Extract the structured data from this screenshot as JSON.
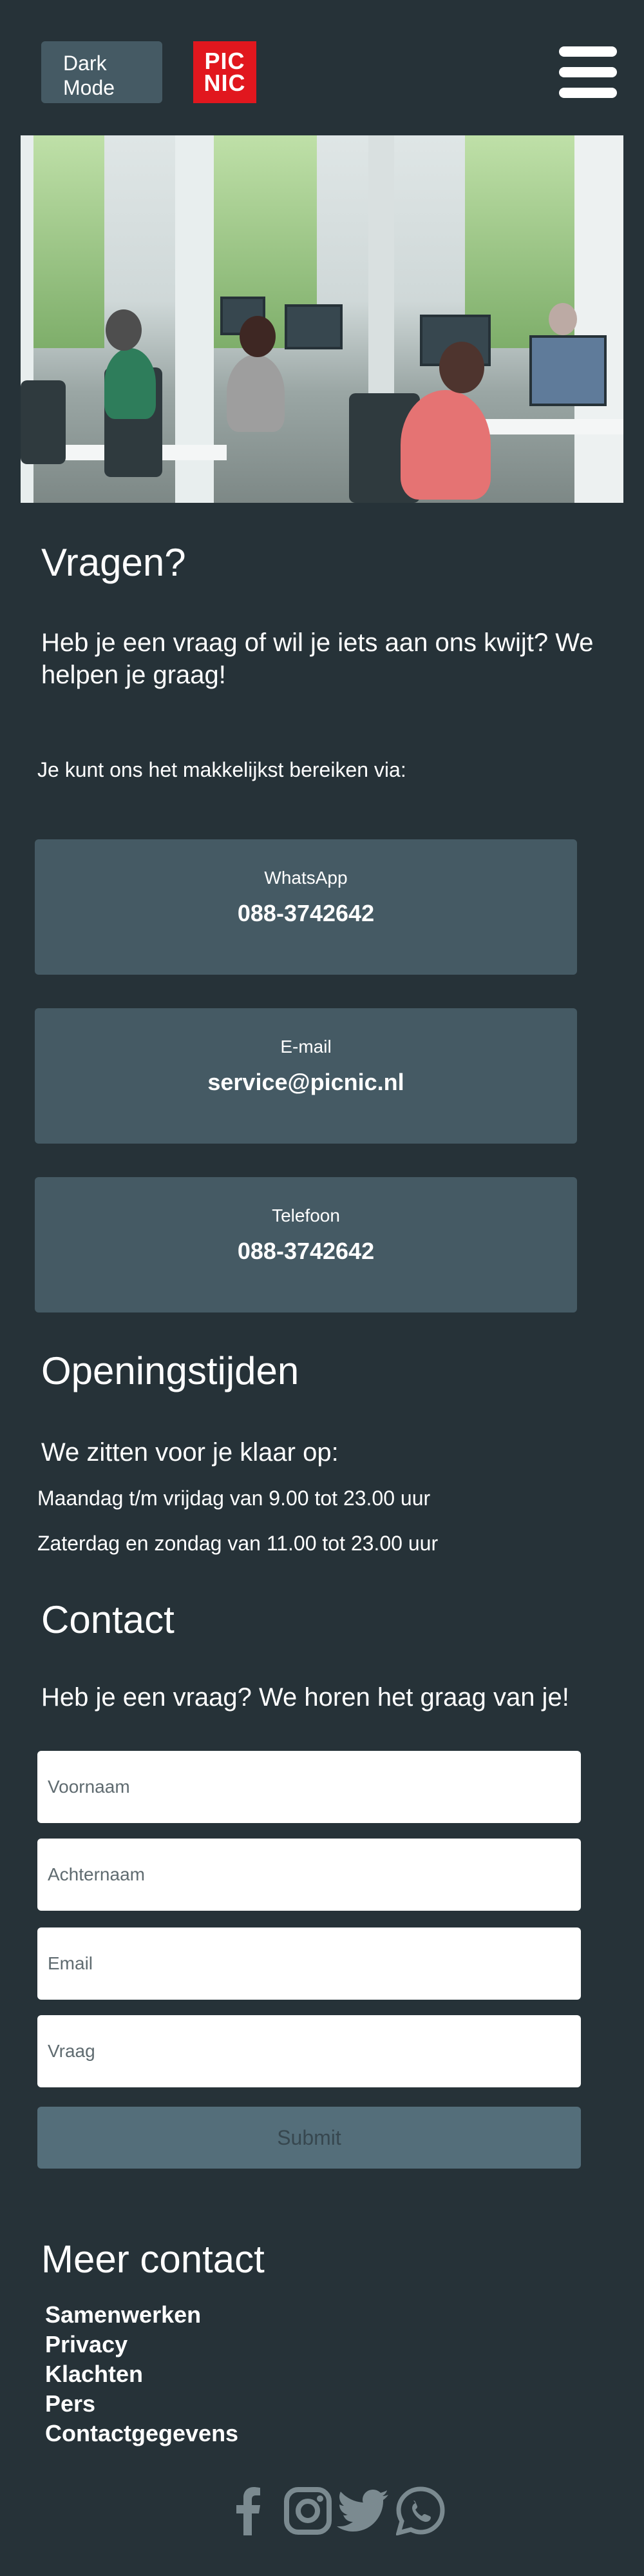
{
  "header": {
    "mode_button": "Dark\nMode",
    "mode_line1": "Dark",
    "mode_line2": "Mode",
    "logo_line1": "PIC",
    "logo_line2": "NIC",
    "brand_color": "#e1171e"
  },
  "intro": {
    "title": "Vragen?",
    "lead": "Heb je een vraag of wil je iets aan ons kwijt? We helpen je graag!",
    "reach": "Je kunt ons het makkelijkst bereiken via:"
  },
  "channels": [
    {
      "label": "WhatsApp",
      "value": "088-3742642"
    },
    {
      "label": "E-mail",
      "value": "service@picnic.nl"
    },
    {
      "label": "Telefoon",
      "value": "088-3742642"
    }
  ],
  "hours": {
    "title": "Openingstijden",
    "lead": "We zitten voor je klaar op:",
    "weekdays": "Maandag t/m vrijdag van 9.00 tot 23.00 uur",
    "weekend": "Zaterdag en zondag van 11.00 tot 23.00 uur"
  },
  "contact": {
    "title": "Contact",
    "lead": "Heb je een vraag? We horen het graag van je!",
    "first_name_placeholder": "Voornaam",
    "last_name_placeholder": "Achternaam",
    "email_placeholder": "Email",
    "question_placeholder": "Vraag",
    "submit_label": "Submit"
  },
  "more": {
    "title": "Meer contact",
    "links": [
      "Samenwerken",
      "Privacy",
      "Klachten",
      "Pers",
      "Contactgegevens"
    ]
  },
  "social_icons": [
    "facebook-icon",
    "instagram-icon",
    "twitter-icon",
    "whatsapp-icon"
  ],
  "colors": {
    "background": "#263238",
    "card": "#455a64",
    "button_disabled": "#546e7a",
    "icon_gray": "#7b8a90"
  }
}
